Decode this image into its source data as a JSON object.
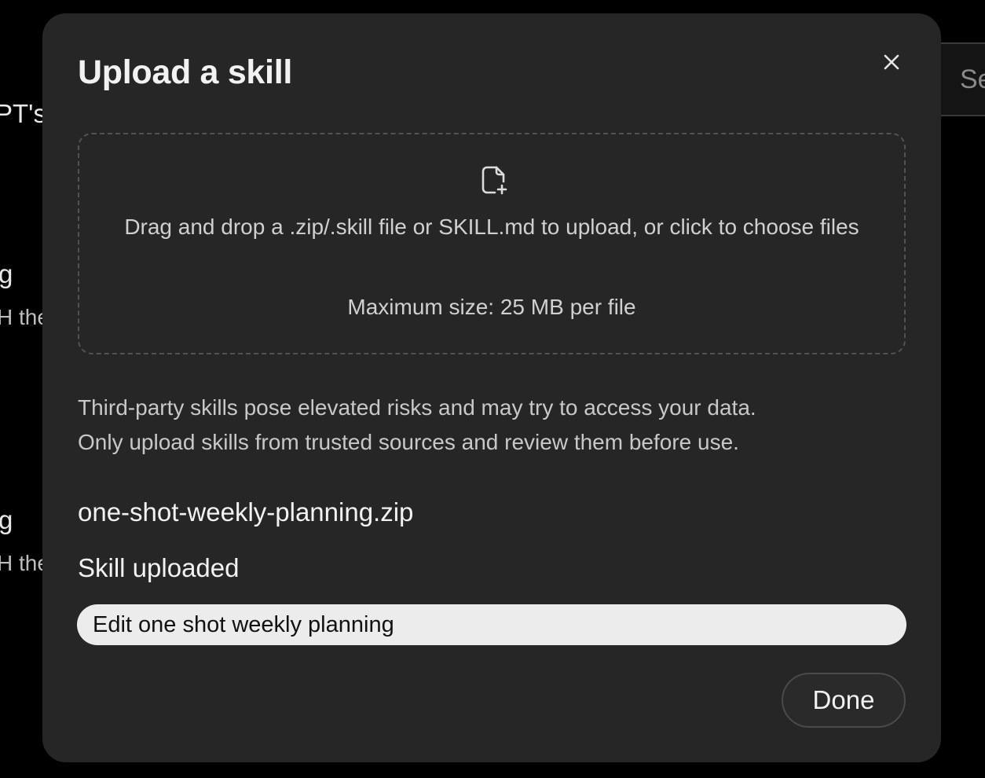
{
  "background": {
    "title_fragment": "PT's",
    "item1_title_fragment": "g",
    "item1_desc_fragment": "H the",
    "item2_title_fragment": "g",
    "item2_desc_fragment": "H the",
    "search_fragment": "Se"
  },
  "modal": {
    "title": "Upload a skill",
    "close_icon": "close-icon",
    "dropzone": {
      "icon": "file-plus-icon",
      "instructions": "Drag and drop a .zip/.skill file or SKILL.md to upload, or click to choose files",
      "max_size": "Maximum size: 25 MB per file"
    },
    "warning_line1": "Third-party skills pose elevated risks and may try to access your data.",
    "warning_line2": "Only upload skills from trusted sources and review them before use.",
    "file_name": "one-shot-weekly-planning.zip",
    "status": "Skill uploaded",
    "edit_button_label": "Edit one shot weekly planning",
    "done_button_label": "Done"
  },
  "colors": {
    "modal_bg": "#262626",
    "page_bg": "#000000",
    "edit_button_bg": "#ececec",
    "text_primary": "#f2f2f2"
  }
}
